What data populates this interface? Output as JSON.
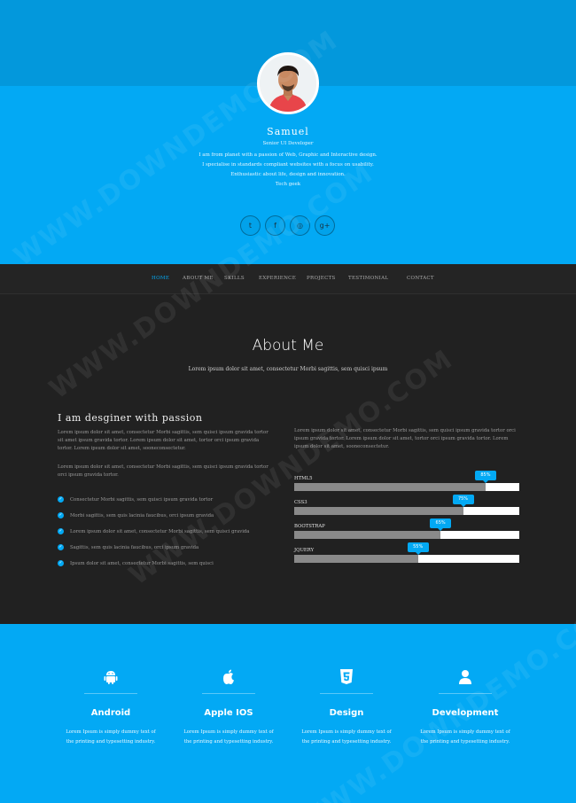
{
  "profile": {
    "name": "Samuel",
    "role": "Senior UI Developer",
    "bio": [
      "I am from planet with a passion of Web, Graphic and Interactive design.",
      "I specialise in standards compliant websites with a focus on usability.",
      "Enthusiastic about life, design and innovation.",
      "Tech geek"
    ]
  },
  "social": [
    {
      "icon": "twitter-icon",
      "glyph": "t"
    },
    {
      "icon": "facebook-icon",
      "glyph": "f"
    },
    {
      "icon": "dribbble-icon",
      "glyph": "◎"
    },
    {
      "icon": "google-plus-icon",
      "glyph": "g+"
    }
  ],
  "nav": [
    "HOME",
    "ABOUT ME",
    "SKILLS",
    "EXPERIENCE",
    "PROJECTS",
    "TESTIMONIAL",
    "CONTACT"
  ],
  "about": {
    "title": "About Me",
    "subtitle": "Lorem ipsum dolor sit amet, consectetur Morbi sagittis, sem quisci ipsum",
    "heading": "I am desginer with passion",
    "para1": "Lorem ipsum dolor sit amet, consectetur Morbi sagittis, sem quisci ipsum gravida tortor sit amet ipsum gravida tortor. Lorem ipsum dolor sit amet, tortor orci ipsum gravida tortor. Lorem ipsum dolor sit amet, sooneconsectetur.",
    "para2": "Lorem ipsum dolor sit amet, consectetur Morbi sagittis, sem quisci ipsum gravida tortor orci ipsum gravida tortor.",
    "checks": [
      "Consectetur Morbi sagittis, sem quisci ipsum gravida tortor",
      "Morbi sagittis, sem quis lacinia faucibus, orci ipsum gravida",
      "Lorem ipsum dolor sit amet, consectetur Morbi sagittis, sem quisci gravida",
      "Sagittis, sem quis lacinia faucibus, orci ipsum gravida",
      "Ipsum dolor sit amet, consectetur Morbi sagittis, sem quisci"
    ],
    "right_para": "Lorem ipsum dolor sit amet, consectetur Morbi sagittis, sem quisci ipsum gravida tortor orci ipsum gravida tortor. Lorem ipsum dolor sit amet, tortor orci ipsum gravida tortor. Lorem ipsum dolor sit amet, sooneconsectetur."
  },
  "skills": [
    {
      "label": "HTML5",
      "value": 85,
      "text": "85%"
    },
    {
      "label": "CSS3",
      "value": 75,
      "text": "75%"
    },
    {
      "label": "BOOTSTRAP",
      "value": 65,
      "text": "65%"
    },
    {
      "label": "JQUERY",
      "value": 55,
      "text": "55%"
    }
  ],
  "services": [
    {
      "title": "Android",
      "icon": "android-icon",
      "text": "Lorem Ipsum is simply dummy text of the printing and typesetting industry."
    },
    {
      "title": "Apple IOS",
      "icon": "apple-icon",
      "text": "Lorem Ipsum is simply dummy text of the printing and typesetting industry."
    },
    {
      "title": "Design",
      "icon": "html5-icon",
      "text": "Lorem Ipsum is simply dummy text of the printing and typesetting industry."
    },
    {
      "title": "Development",
      "icon": "user-icon",
      "text": "Lorem Ipsum is simply dummy text of the printing and typesetting industry."
    }
  ],
  "watermark": "WWW.DOWNDEMO.COM",
  "colors": {
    "accent": "#03a9f4",
    "dark": "#212121",
    "hero_top": "#0398dc"
  }
}
